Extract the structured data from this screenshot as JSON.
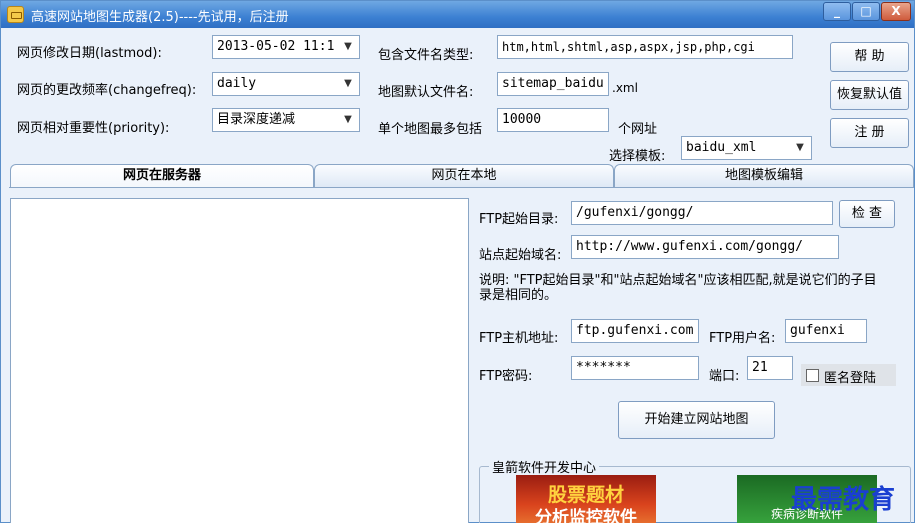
{
  "window": {
    "title": "高速网站地图生成器(2.5)----先试用，后注册",
    "controls": {
      "minimize": "_",
      "maximize": "□",
      "close": "X"
    }
  },
  "form": {
    "lastmod": {
      "label": "网页修改日期(lastmod):",
      "value": "2013-05-02 11:1"
    },
    "changefreq": {
      "label": "网页的更改频率(changefreq):",
      "value": "daily"
    },
    "priority": {
      "label": "网页相对重要性(priority):",
      "value": "目录深度递减"
    },
    "filetypes": {
      "label": "包含文件名类型:",
      "value": "htm,html,shtml,asp,aspx,jsp,php,cgi"
    },
    "default_filename": {
      "label": "地图默认文件名:",
      "value": "sitemap_baidu",
      "suffix": ".xml"
    },
    "max_urls": {
      "label": "单个地图最多包括",
      "value": "10000",
      "suffix": "个网址"
    },
    "template": {
      "label": "选择模板:",
      "value": "baidu_xml"
    }
  },
  "buttons": {
    "help": "帮 助",
    "restore_defaults": "恢复默认值",
    "register": "注 册"
  },
  "tabs": [
    "网页在服务器",
    "网页在本地",
    "地图模板编辑"
  ],
  "ftp": {
    "start_dir": {
      "label": "FTP起始目录:",
      "value": "/gufenxi/gongg/",
      "button": "检 查"
    },
    "start_domain": {
      "label": "站点起始域名:",
      "value": "http://www.gufenxi.com/gongg/"
    },
    "note": "说明: \"FTP起始目录\"和\"站点起始域名\"应该相匹配,就是说它们的子目录是相同的。",
    "host": {
      "label": "FTP主机地址:",
      "value": "ftp.gufenxi.com"
    },
    "user": {
      "label": "FTP用户名:",
      "value": "gufenxi"
    },
    "password": {
      "label": "FTP密码:",
      "value": "*******"
    },
    "port": {
      "label": "端口:",
      "value": "21"
    },
    "anonymous": {
      "label": "匿名登陆",
      "checked": false
    },
    "start_button": "开始建立网站地图"
  },
  "group": {
    "title": "皇箭软件开发中心",
    "banner1": {
      "line1": "股票题材",
      "line2": "分析监控软件"
    },
    "banner2": {
      "line1": "疾病诊断软件"
    }
  },
  "watermark": "最需教育"
}
